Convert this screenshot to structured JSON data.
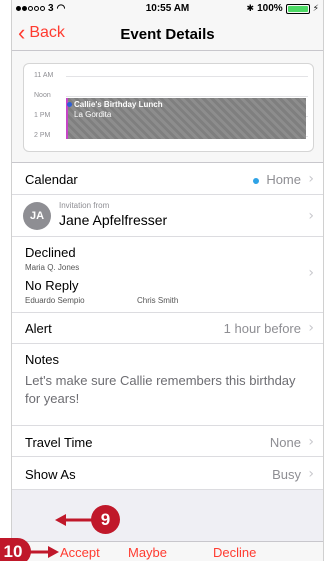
{
  "status_bar": {
    "carrier": "3",
    "time": "10:55 AM",
    "battery_pct": "100%",
    "battery_level": 1.0
  },
  "nav": {
    "back_label": "Back",
    "title": "Event Details"
  },
  "calendar_preview": {
    "hours": [
      "11 AM",
      "Noon",
      "1 PM",
      "2 PM"
    ],
    "event_title": "Callie's Birthday Lunch",
    "event_location": "La Gordita"
  },
  "rows": {
    "calendar": {
      "label": "Calendar",
      "value": "Home"
    },
    "invitation": {
      "from_label": "Invitation from",
      "name": "Jane Apfelfresser",
      "initials": "JA"
    },
    "attendees": {
      "declined_label": "Declined",
      "declined_names": [
        "Maria Q. Jones"
      ],
      "no_reply_label": "No Reply",
      "no_reply_names": [
        "Eduardo Sempio",
        "Chris Smith"
      ]
    },
    "alert": {
      "label": "Alert",
      "value": "1 hour before"
    },
    "notes": {
      "label": "Notes",
      "text": "Let's make sure Callie remembers this birthday for years!"
    },
    "travel_time": {
      "label": "Travel Time",
      "value": "None"
    },
    "show_as": {
      "label": "Show As",
      "value": "Busy"
    }
  },
  "bottom_bar": {
    "accept": "Accept",
    "maybe": "Maybe",
    "decline": "Decline"
  },
  "callouts": [
    "9",
    "10"
  ],
  "colors": {
    "accent": "#ff3b30",
    "calendar_dot": "#2fa3e6",
    "callout": "#c0182a",
    "event_border": "#c644c6"
  },
  "icons": {
    "chevron": "chevron-right-icon",
    "back": "chevron-left-icon"
  }
}
